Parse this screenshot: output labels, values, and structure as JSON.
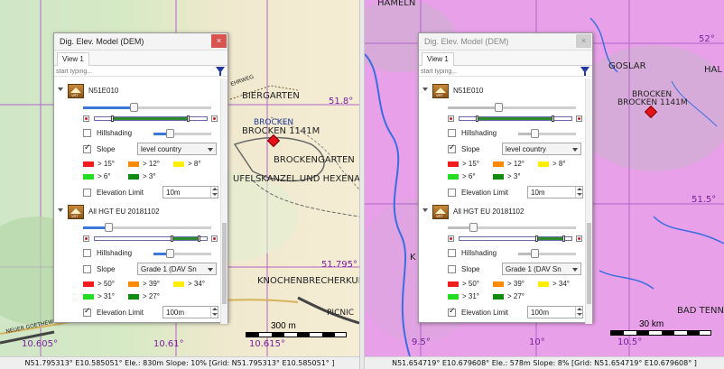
{
  "left": {
    "map": {
      "labels": {
        "biergarten": "BIERGARTEN",
        "brocken_blue": "BROCKEN",
        "brocken": "BROCKEN 1141M",
        "brockengarten": "BROCKENGARTEN",
        "teufelskanzel": "UFELSKANZEL UND HEXENALT",
        "knochen": "KNOCHENBRECHERKUR",
        "picnic": "PICNIC",
        "weg": "NEUER GOETHEWEG",
        "vehrweg": "EHRWEG"
      },
      "coords": {
        "c1": "51.8°",
        "c2": "51.795°",
        "c3": "10.605°",
        "c4": "10.61°",
        "c5": "10.615°"
      },
      "scale_label": "300 m"
    },
    "status": "N51.795313° E10.585051° Ele.: 830m Slope: 10% [Grid: N51.795313° E10.585051° ]"
  },
  "right": {
    "map": {
      "labels": {
        "hameln": "HAMELN",
        "goslar": "GOSLAR",
        "hal": "HAL",
        "brocken": "BROCKEN",
        "brocken_elev": "BROCKEN 1141M",
        "bad": "BAD TENNST",
        "k": "K"
      },
      "coords": {
        "c1": "52°",
        "c2": "51.5°",
        "c3": "9.5°",
        "c4": "10°",
        "c5": "10.5°"
      },
      "scale_label": "30 km"
    },
    "status": "N51.654719° E10.679608° Ele.: 578m Slope: 8% [Grid: N51.654719° E10.679608° ]"
  },
  "dem": {
    "title": "Dig. Elev. Model (DEM)",
    "close": "×",
    "tab": "View 1",
    "filter_placeholder": "start typing...",
    "vrt": "VRT",
    "layer1": {
      "name": "N51E010",
      "hillshading": "Hillshading",
      "slope": "Slope",
      "slope_mode": "level country",
      "legend": [
        "> 15°",
        "> 12°",
        "> 8°",
        "> 6°",
        "> 3°"
      ],
      "elevation_limit": "Elevation Limit",
      "elevation_value": "10m"
    },
    "layer2": {
      "name": "All HGT EU 20181102",
      "hillshading": "Hillshading",
      "slope": "Slope",
      "slope_mode": "Grade 1 (DAV Sn",
      "legend": [
        "> 50°",
        "> 39°",
        "> 34°",
        "> 31°",
        "> 27°"
      ],
      "elevation_limit": "Elevation Limit",
      "elevation_value_left": "100m",
      "elevation_value_right": "100m"
    }
  },
  "colors": {
    "red": "#ee1c1c",
    "orange": "#ff8a00",
    "yellow": "#ffee00",
    "light_green": "#22dd22",
    "dark_green": "#108a10"
  }
}
